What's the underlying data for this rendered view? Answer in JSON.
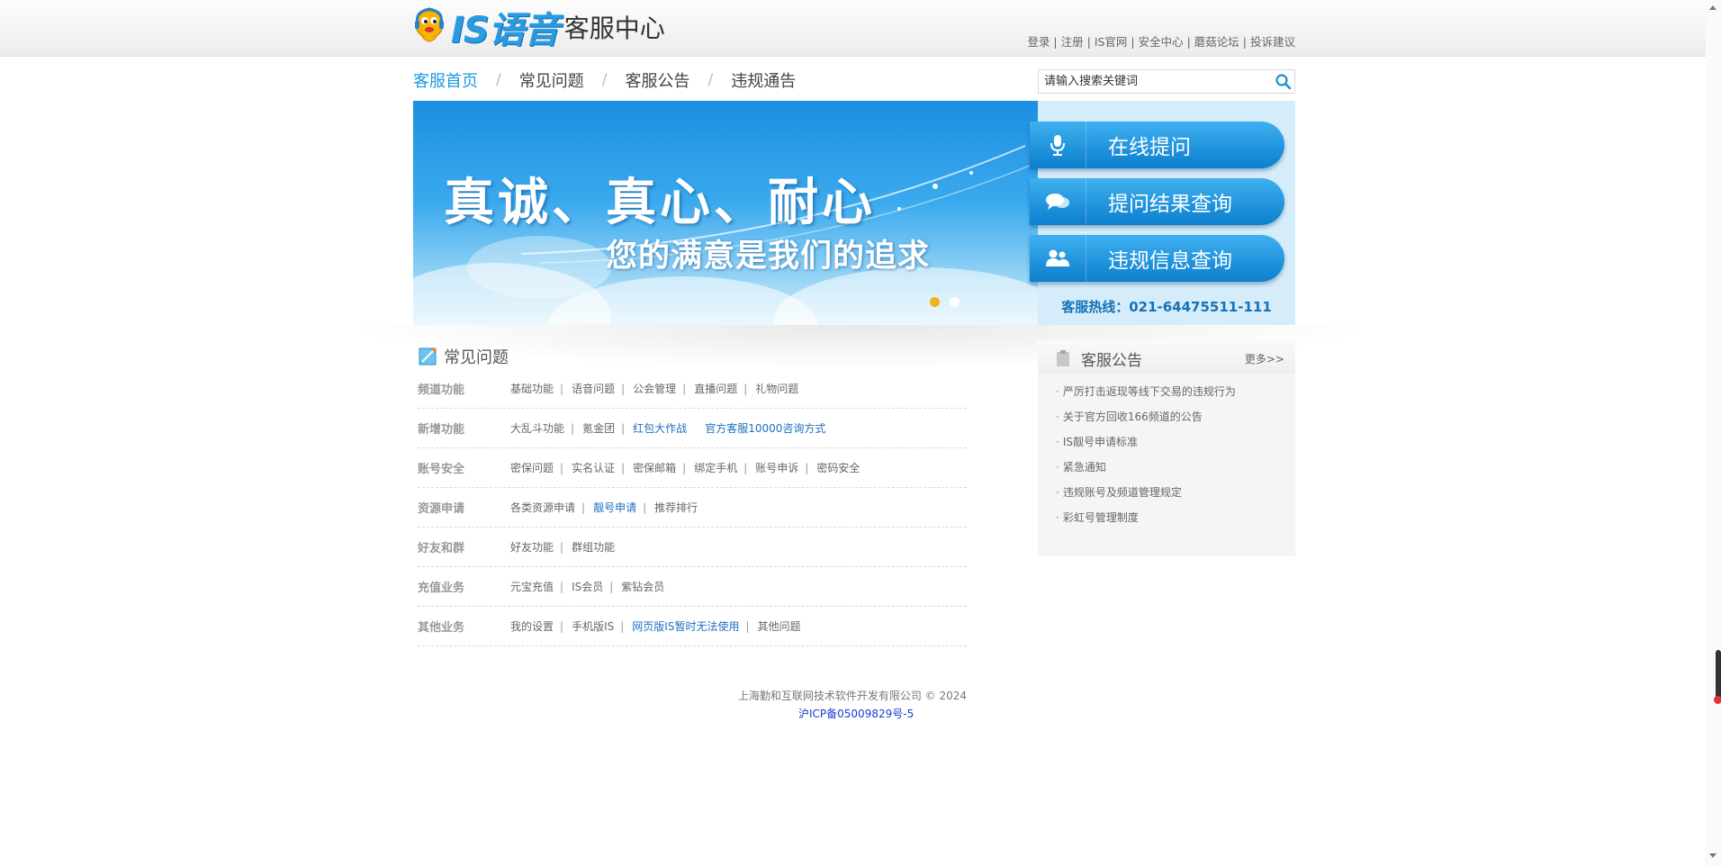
{
  "header": {
    "logo_text": "IS语音",
    "logo_subtitle": "客服中心",
    "top_links": [
      "登录",
      "注册",
      "IS官网",
      "安全中心",
      "蘑菇论坛",
      "投诉建议"
    ],
    "top_sep": " | "
  },
  "nav": {
    "items": [
      "客服首页",
      "常见问题",
      "客服公告",
      "违规通告"
    ],
    "active_index": 0,
    "separator": "/"
  },
  "search": {
    "placeholder": "请输入搜索关键词"
  },
  "banner": {
    "headline": "真诚、真心、耐心",
    "subline": "您的满意是我们的追求",
    "slide_count": 2,
    "active_slide": 0
  },
  "side": {
    "buttons": [
      "在线提问",
      "提问结果查询",
      "违规信息查询"
    ],
    "hotline": "客服热线：021-64475511-111"
  },
  "faq": {
    "title": "常见问题",
    "rows": [
      {
        "category": "频道功能",
        "links": [
          {
            "t": "基础功能",
            "hl": false
          },
          {
            "t": "语音问题",
            "hl": false
          },
          {
            "t": "公会管理",
            "hl": false
          },
          {
            "t": "直播问题",
            "hl": false
          },
          {
            "t": "礼物问题",
            "hl": false
          }
        ]
      },
      {
        "category": "新增功能",
        "links": [
          {
            "t": "大乱斗功能",
            "hl": false
          },
          {
            "t": "氪金团",
            "hl": false
          },
          {
            "t": "红包大作战",
            "hl": true
          },
          {
            "t": "官方客服10000咨询方式",
            "hl": true
          }
        ]
      },
      {
        "category": "账号安全",
        "links": [
          {
            "t": "密保问题",
            "hl": false
          },
          {
            "t": "实名认证",
            "hl": false
          },
          {
            "t": "密保邮箱",
            "hl": false
          },
          {
            "t": "绑定手机",
            "hl": false
          },
          {
            "t": "账号申诉",
            "hl": false
          },
          {
            "t": "密码安全",
            "hl": false
          }
        ]
      },
      {
        "category": "资源申请",
        "links": [
          {
            "t": "各类资源申请",
            "hl": false
          },
          {
            "t": "靓号申请",
            "hl": true
          },
          {
            "t": "推荐排行",
            "hl": false
          }
        ]
      },
      {
        "category": "好友和群",
        "links": [
          {
            "t": "好友功能",
            "hl": false
          },
          {
            "t": "群组功能",
            "hl": false
          }
        ]
      },
      {
        "category": "充值业务",
        "links": [
          {
            "t": "元宝充值",
            "hl": false
          },
          {
            "t": "IS会员",
            "hl": false
          },
          {
            "t": "紫钻会员",
            "hl": false
          }
        ]
      },
      {
        "category": "其他业务",
        "links": [
          {
            "t": "我的设置",
            "hl": false
          },
          {
            "t": "手机版IS",
            "hl": false
          },
          {
            "t": "网页版IS暂时无法使用",
            "hl": true
          },
          {
            "t": "其他问题",
            "hl": false
          }
        ]
      }
    ],
    "link_sep": "|"
  },
  "notice": {
    "title": "客服公告",
    "more": "更多>>",
    "bullet": "·",
    "items": [
      "严厉打击返现等线下交易的违规行为",
      "关于官方回收166频道的公告",
      "IS靓号申请标准",
      "紧急通知",
      "违规账号及频道管理规定",
      "彩虹号管理制度"
    ]
  },
  "footer": {
    "copyright": "上海勤和互联网技术软件开发有限公司 © 2024",
    "icp": "沪ICP备05009829号-5"
  },
  "colors": {
    "accent": "#1e9ae0",
    "link_highlight": "#1b6fbf",
    "hotline": "#1672b8",
    "dot_active": "#f3b21a",
    "dot_inactive": "#ffffff"
  }
}
